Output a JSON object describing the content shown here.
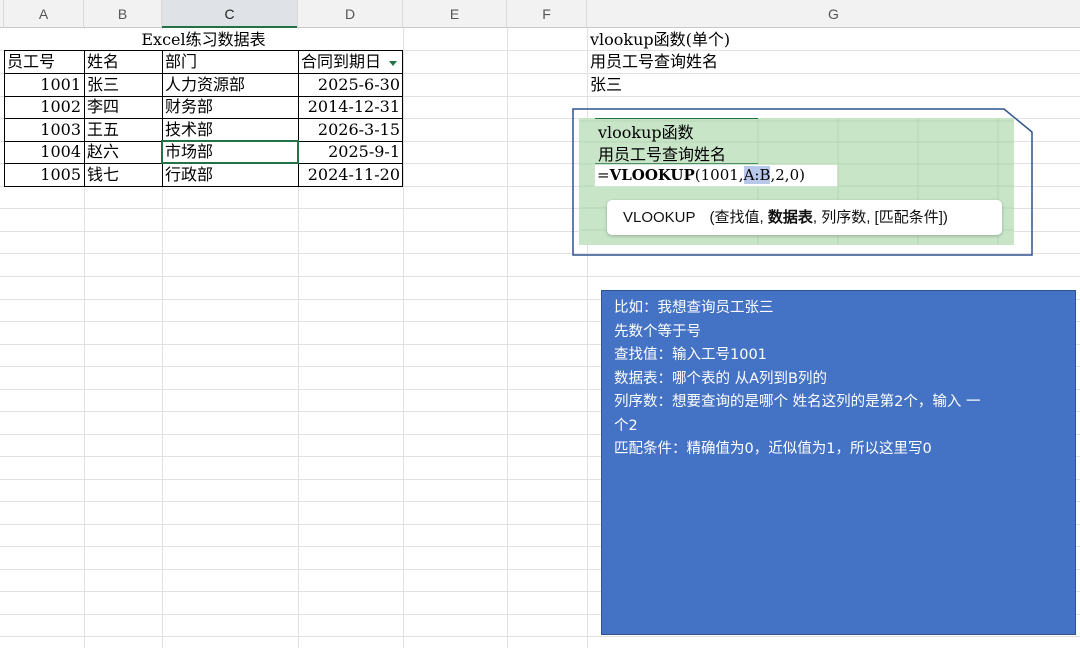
{
  "columns": [
    "A",
    "B",
    "C",
    "D",
    "E",
    "F",
    "G"
  ],
  "selected_column": "C",
  "table": {
    "title": "Excel练习数据表",
    "headers": [
      "员工号",
      "姓名",
      "部门",
      "合同到期日"
    ],
    "rows": [
      [
        "1001",
        "张三",
        "人力资源部",
        "2025-6-30"
      ],
      [
        "1002",
        "李四",
        "财务部",
        "2014-12-31"
      ],
      [
        "1003",
        "王五",
        "技术部",
        "2026-3-15"
      ],
      [
        "1004",
        "赵六",
        "市场部",
        "2025-9-1"
      ],
      [
        "1005",
        "钱七",
        "行政部",
        "2024-11-20"
      ]
    ]
  },
  "side_notes": {
    "g1": "vlookup函数(单个)",
    "g2": "用员工号查询姓名",
    "g3": "张三"
  },
  "embedded": {
    "line1": "vlookup函数",
    "line2": "用员工号查询姓名",
    "formula_eq": "=",
    "formula_fn": "VLOOKUP",
    "formula_open": "(1001,",
    "formula_range": "A:B",
    "formula_rest": ",2,0)",
    "tooltip_fn": "VLOOKUP",
    "tooltip_open": "(查找值,",
    "tooltip_bold": "数据表",
    "tooltip_rest": ", 列序数, [匹配条件])"
  },
  "explanation": [
    "比如：我想查询员工张三",
    "先数个等于号",
    "查找值：输入工号1001",
    "数据表：哪个表的 从A列到B列的",
    "列序数：想要查询的是哪个 姓名这列的是第2个，输入  一",
    "个2",
    "匹配条件：精确值为0，近似值为1，所以这里写0"
  ],
  "colors": {
    "accent_green": "#217346",
    "note_blue": "#4472c4",
    "embed_green": "#c8e5c8"
  }
}
